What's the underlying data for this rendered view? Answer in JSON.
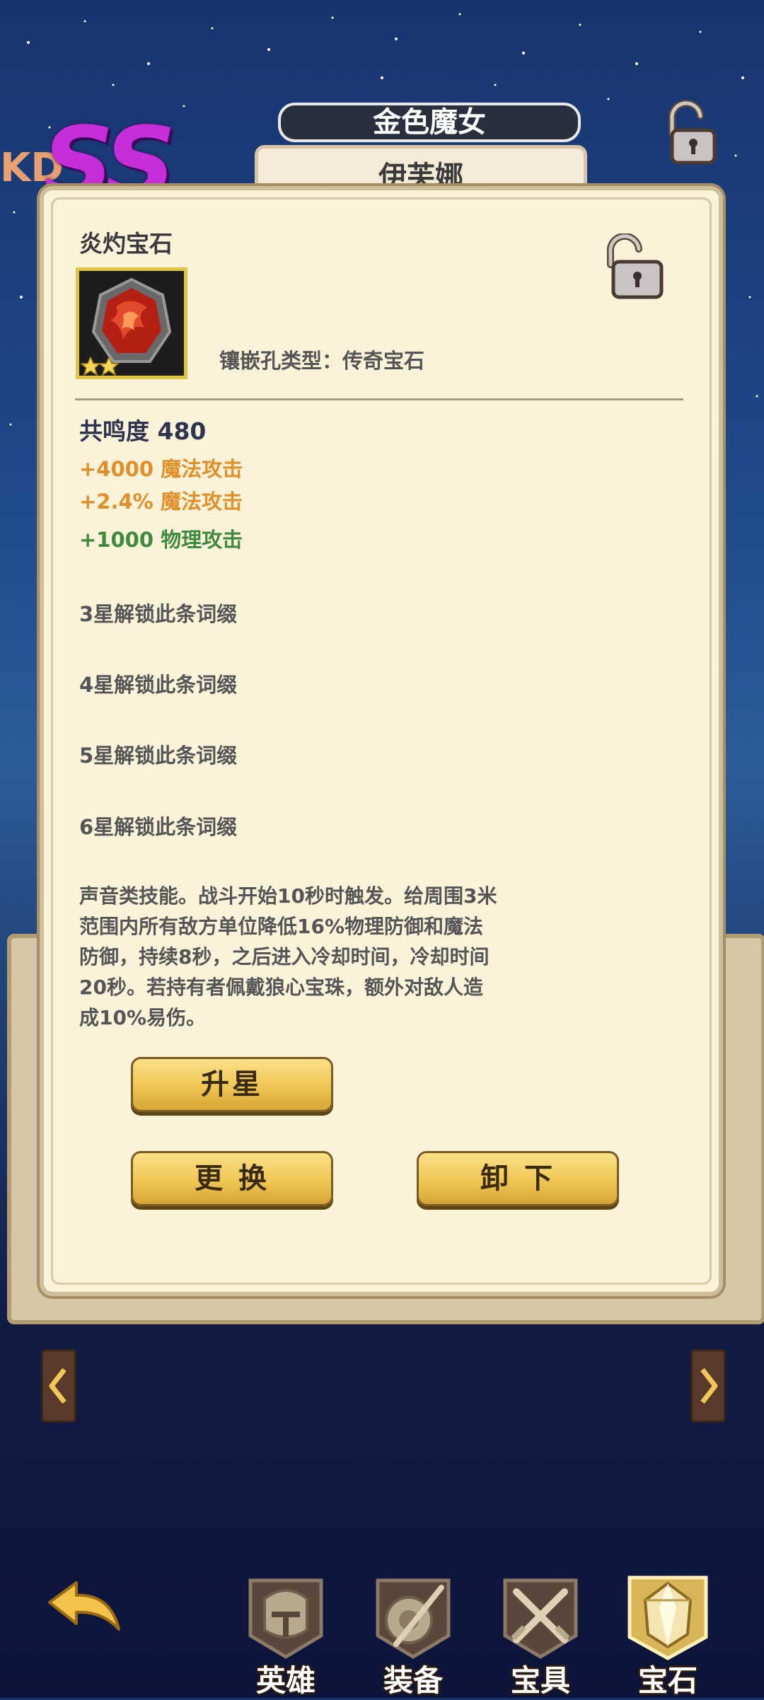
{
  "header": {
    "grade": "SS",
    "grade_prefix": "KD",
    "hero_title": "金色魔女",
    "hero_name": "伊芙娜"
  },
  "gem": {
    "name": "炎灼宝石",
    "stars": 2,
    "slot_type": "镶嵌孔类型：传奇宝石"
  },
  "stats": {
    "resonance": "共鸣度 480",
    "attributes": [
      {
        "text": "+4000 魔法攻击",
        "color": "#e08f2a"
      },
      {
        "text": "+2.4% 魔法攻击",
        "color": "#e08f2a"
      },
      {
        "text": "+1000 物理攻击",
        "color": "#3f8a3f"
      }
    ],
    "locked_affixes": [
      "3星解锁此条词缀",
      "4星解锁此条词缀",
      "5星解锁此条词缀",
      "6星解锁此条词缀"
    ]
  },
  "description": [
    "声音类技能。战斗开始10秒时触发。给周围3米",
    "范围内所有敌方单位降低16%物理防御和魔法",
    "防御，持续8秒，之后进入冷却时间，冷却时间",
    "20秒。若持有者佩戴狼心宝珠，额外对敌人造",
    "成10%易伤。"
  ],
  "buttons": {
    "upgrade": "升星",
    "replace": "更 换",
    "unequip": "卸 下"
  },
  "nav": {
    "items": [
      {
        "label": "英雄",
        "icon": "helmet-icon"
      },
      {
        "label": "装备",
        "icon": "shield-sword-icon"
      },
      {
        "label": "宝具",
        "icon": "crossed-swords-icon"
      },
      {
        "label": "宝石",
        "icon": "gem-icon",
        "active": true
      }
    ]
  }
}
